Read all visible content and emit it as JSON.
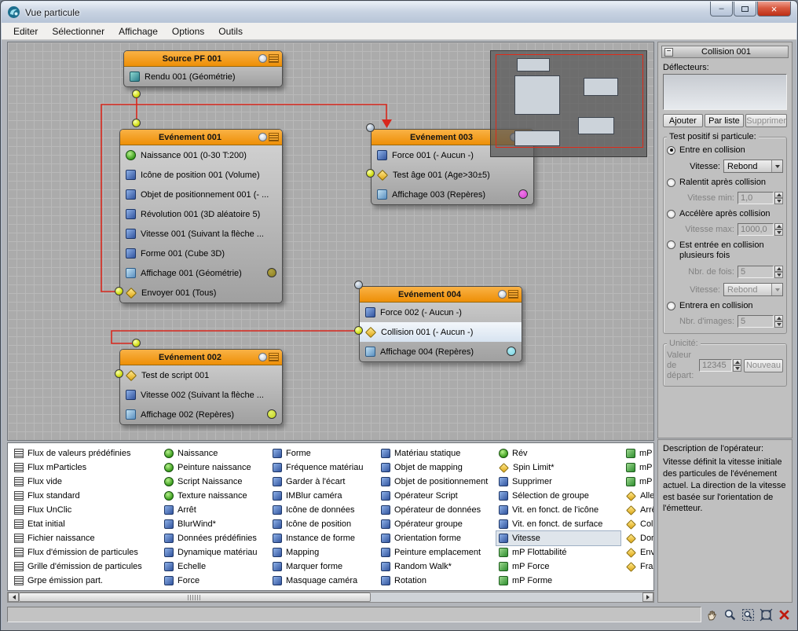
{
  "titlebar": {
    "title": "Vue particule"
  },
  "icons": {
    "minimize": "–",
    "close": "×",
    "collapse": "−"
  },
  "menu": [
    "Editer",
    "Sélectionner",
    "Affichage",
    "Options",
    "Outils"
  ],
  "nodes": {
    "src": {
      "title": "Source PF 001",
      "rows": [
        "Rendu 001 (Géométrie)"
      ]
    },
    "e1": {
      "title": "Evénement 001",
      "rows": [
        "Naissance 001 (0-30 T:200)",
        "Icône de position 001 (Volume)",
        "Objet de positionnement 001 (- ...",
        "Révolution 001 (3D aléatoire 5)",
        "Vitesse 001 (Suivant la flèche ...",
        "Forme 001 (Cube 3D)",
        "Affichage 001 (Géométrie)",
        "Envoyer 001 (Tous)"
      ]
    },
    "e3": {
      "title": "Evénement 003",
      "rows": [
        "Force 001 (- Aucun -)",
        "Test âge 001 (Age>30±5)",
        "Affichage 003 (Repères)"
      ]
    },
    "e4": {
      "title": "Evénement 004",
      "rows": [
        "Force 002 (- Aucun -)",
        "Collision 001 (- Aucun -)",
        "Affichage 004 (Repères)"
      ]
    },
    "e2": {
      "title": "Evénement 002",
      "rows": [
        "Test de script 001",
        "Vitesse 002 (Suivant la flèche ...",
        "Affichage 002 (Repères)"
      ]
    }
  },
  "wires": [
    {
      "from": "Source PF 001",
      "to": "Evénement 001"
    },
    {
      "from": "Envoyer 001 (Tous)",
      "to": "Evénement 003"
    },
    {
      "from": "Collision 001",
      "to": "Evénement 002"
    }
  ],
  "display_colors": {
    "affichage_001": "#8a7d1c",
    "affichage_003": "#d23fd2",
    "affichage_004": "#79d2e0",
    "affichage_002": "#c2d21e"
  },
  "wire_color": "#d8271c",
  "panel": {
    "title": "Collision 001",
    "deflectors_label": "Déflecteurs:",
    "add": "Ajouter",
    "by_list": "Par liste",
    "remove": "Supprimer",
    "group_title": "Test positif si particule:",
    "opt_collides": "Entre en collision",
    "speed_label": "Vitesse:",
    "speed_value": "Rebond",
    "opt_slows": "Ralentit après collision",
    "vmin_label": "Vitesse min:",
    "vmin_value": "1,0",
    "opt_accel": "Accélère après collision",
    "vmax_label": "Vitesse max:",
    "vmax_value": "1000,0",
    "opt_multiple": "Est entrée en collision plusieurs fois",
    "ntimes_label": "Nbr. de fois:",
    "ntimes_value": "5",
    "speed2_label": "Vitesse:",
    "speed2_value": "Rebond",
    "opt_will": "Entrera en collision",
    "nframes_label": "Nbr. d'images:",
    "nframes_value": "5",
    "unicity_title": "Unicité:",
    "seed_label": "Valeur de départ:",
    "seed_value": "12345",
    "new_btn": "Nouveau"
  },
  "desc": {
    "title": "Description de l'opérateur:",
    "text": "Vitesse définit la vitesse initiale des particules de l'événement actuel. La direction de la vitesse est basée sur l'orientation de l'émetteur."
  },
  "depot": {
    "columns": [
      [
        "Flux de valeurs prédéfinies",
        "Flux mParticles",
        "Flux vide",
        "Flux standard",
        "Flux UnClic",
        "Etat initial",
        "Fichier naissance",
        "Flux d'émission de particules",
        "Grille d'émission de particules",
        "Grpe émission part."
      ],
      [
        "Naissance",
        "Peinture naissance",
        "Script Naissance",
        "Texture naissance",
        "Arrêt",
        "BlurWind*",
        "Données prédéfinies",
        "Dynamique matériau",
        "Echelle",
        "Force"
      ],
      [
        "Forme",
        "Fréquence matériau",
        "Garder à l'écart",
        "IMBlur caméra",
        "Icône de données",
        "Icône de position",
        "Instance de forme",
        "Mapping",
        "Marquer forme",
        "Masquage caméra"
      ],
      [
        "Matériau statique",
        "Objet de mapping",
        "Objet de positionnement",
        "Opérateur Script",
        "Opérateur de données",
        "Opérateur groupe",
        "Orientation forme",
        "Peinture emplacement",
        "Random Walk*",
        "Rotation"
      ],
      [
        "Rév",
        "Spin Limit*",
        "Supprimer",
        "Sélection de groupe",
        "Vit. en fonct. de l'icône",
        "Vit. en fonct. de surface",
        "Vitesse",
        "mP Flottabilité",
        "mP Force",
        "mP Forme"
      ],
      [
        "mP",
        "mP",
        "mP",
        "Aller",
        "Arrêt",
        "Colli",
        "Don",
        "Env",
        "Fract"
      ]
    ]
  }
}
